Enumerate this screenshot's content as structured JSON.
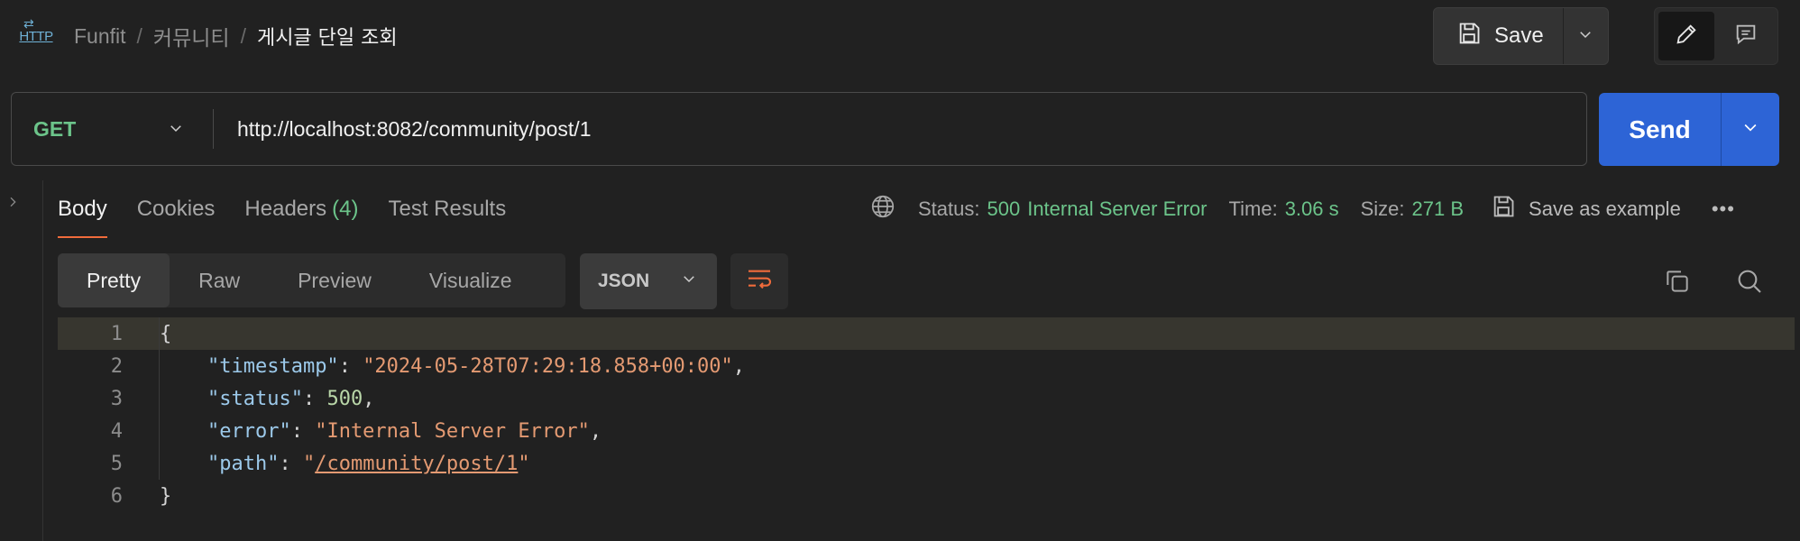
{
  "header": {
    "http_badge": "HTTP",
    "breadcrumb": [
      "Funfit",
      "커뮤니티",
      "게시글 단일 조회"
    ],
    "separator": "/",
    "save_label": "Save"
  },
  "request": {
    "method": "GET",
    "url": "http://localhost:8082/community/post/1",
    "send_label": "Send"
  },
  "response": {
    "tabs": {
      "body": "Body",
      "cookies": "Cookies",
      "headers": "Headers",
      "headers_count": "(4)",
      "tests": "Test Results"
    },
    "status_label": "Status:",
    "status_code": "500",
    "status_text": "Internal Server Error",
    "time_label": "Time:",
    "time_value": "3.06 s",
    "size_label": "Size:",
    "size_value": "271 B",
    "save_example_label": "Save as example",
    "more": "•••"
  },
  "format": {
    "modes": [
      "Pretty",
      "Raw",
      "Preview",
      "Visualize"
    ],
    "language": "JSON"
  },
  "body_lines": {
    "l1": "{",
    "l2_key": "\"timestamp\"",
    "l2_val": "\"2024-05-28T07:29:18.858+00:00\"",
    "l3_key": "\"status\"",
    "l3_val": "500",
    "l4_key": "\"error\"",
    "l4_val": "\"Internal Server Error\"",
    "l5_key": "\"path\"",
    "l5_val_q1": "\"",
    "l5_val_link": "/community/post/1",
    "l5_val_q2": "\"",
    "l6": "}",
    "line_numbers": [
      "1",
      "2",
      "3",
      "4",
      "5",
      "6"
    ]
  },
  "colors": {
    "accent_orange": "#f06b3b",
    "send_blue": "#2d64d6",
    "success_green": "#6cc48a"
  }
}
